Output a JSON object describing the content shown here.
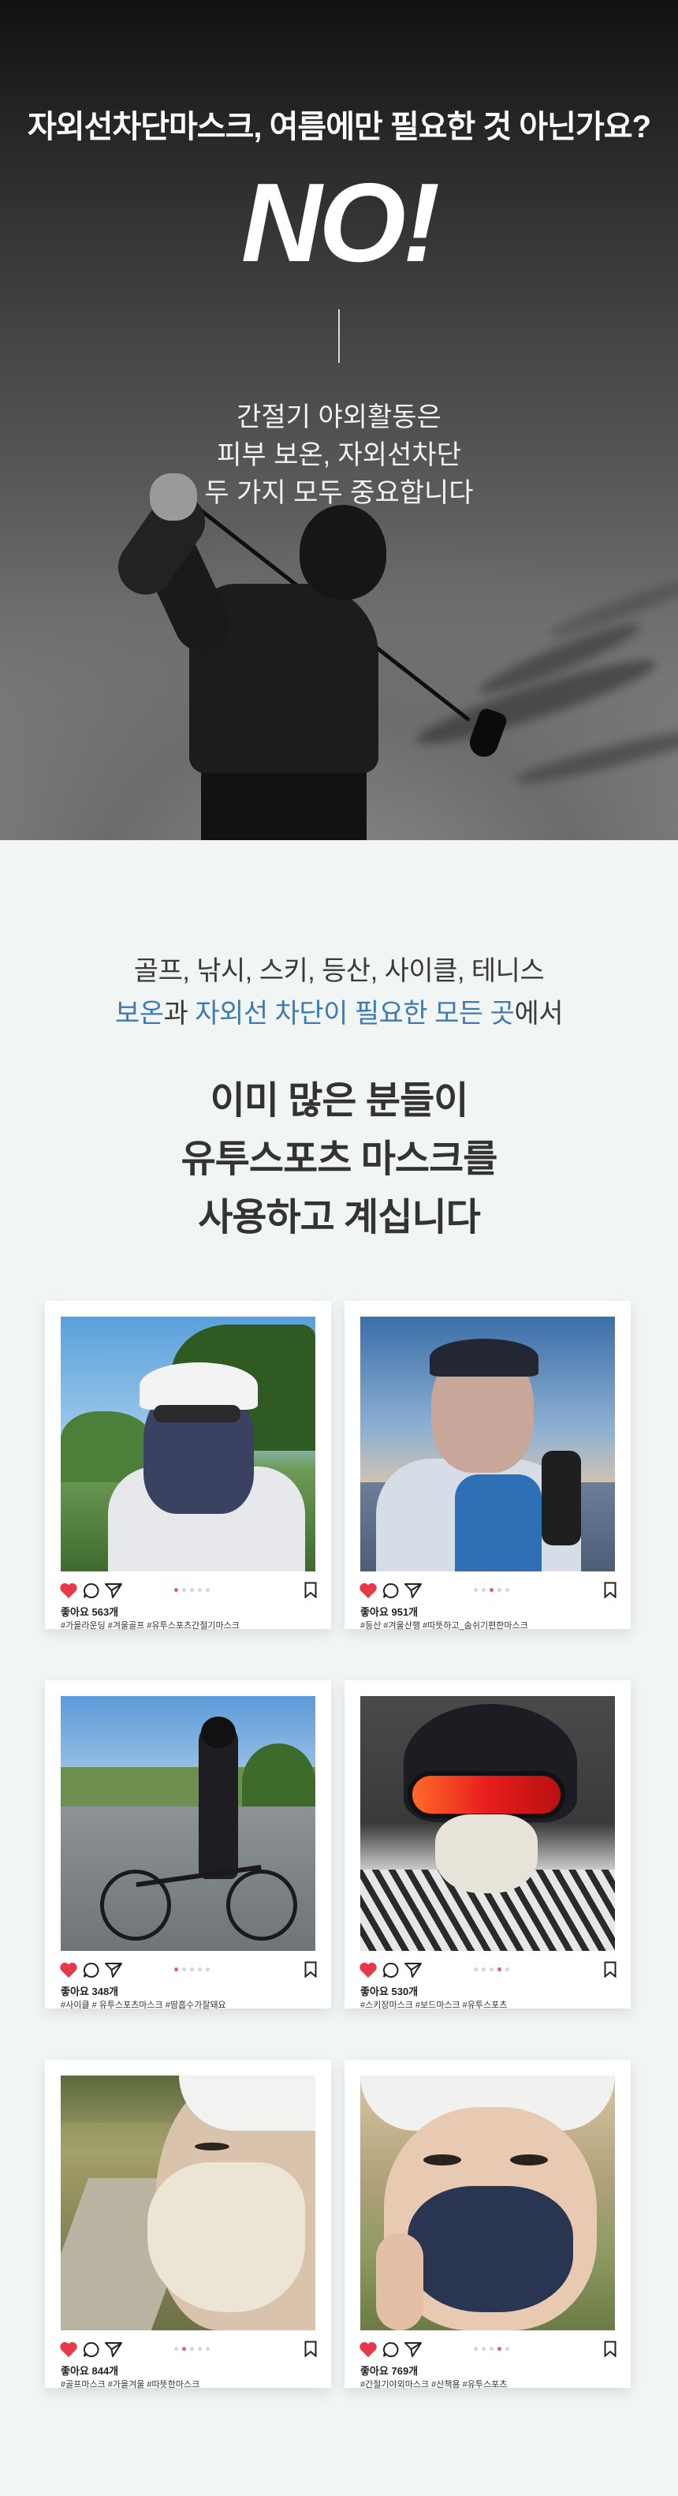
{
  "hero": {
    "question": "자외선차단마스크, 여름에만 필요한 것 아닌가요?",
    "answer": "NO!",
    "lines": [
      "간절기 야외활동은",
      "피부 보온, 자외선차단",
      "두 가지 모두 중요합니다"
    ]
  },
  "intro": {
    "sports": "골프, 낚시, 스키, 등산, 사이클, 테니스",
    "sub_parts": [
      "보온",
      "과 ",
      "자외선 차단이 필요한 모든 곳",
      "에서"
    ],
    "headline": [
      "이미 많은 분들이",
      "유투스포츠 마스크를",
      "사용하고 계십니다"
    ]
  },
  "colors": {
    "accent_blue": "#3f7bb0",
    "heart_red": "#e8394a",
    "background": "#f1f5f4"
  },
  "posts": [
    {
      "likes": "좋아요 563개",
      "tags": "#가을라운딩 #겨울골프 #유투스포츠간절기마스크",
      "active_dot": 0
    },
    {
      "likes": "좋아요 951개",
      "tags": "#등산 #겨울산행 #따뜻하고_숨쉬기편한마스크",
      "active_dot": 2
    },
    {
      "likes": "좋아요 348개",
      "tags": "#사이클 # 유투스포츠마스크 #땀흡수가잘돼요",
      "active_dot": 0
    },
    {
      "likes": "좋아요 530개",
      "tags": "#스키장마스크 #보드마스크 #유투스포츠",
      "active_dot": 3
    },
    {
      "likes": "좋아요 844개",
      "tags": "#골프마스크 #가을겨울 #따뜻한마스크",
      "active_dot": 1
    },
    {
      "likes": "좋아요 769개",
      "tags": "#간절기야외마스크 #산책용 #유투스포츠",
      "active_dot": 3
    }
  ],
  "icons": [
    "heart-icon",
    "comment-icon",
    "send-icon",
    "bookmark-icon"
  ]
}
